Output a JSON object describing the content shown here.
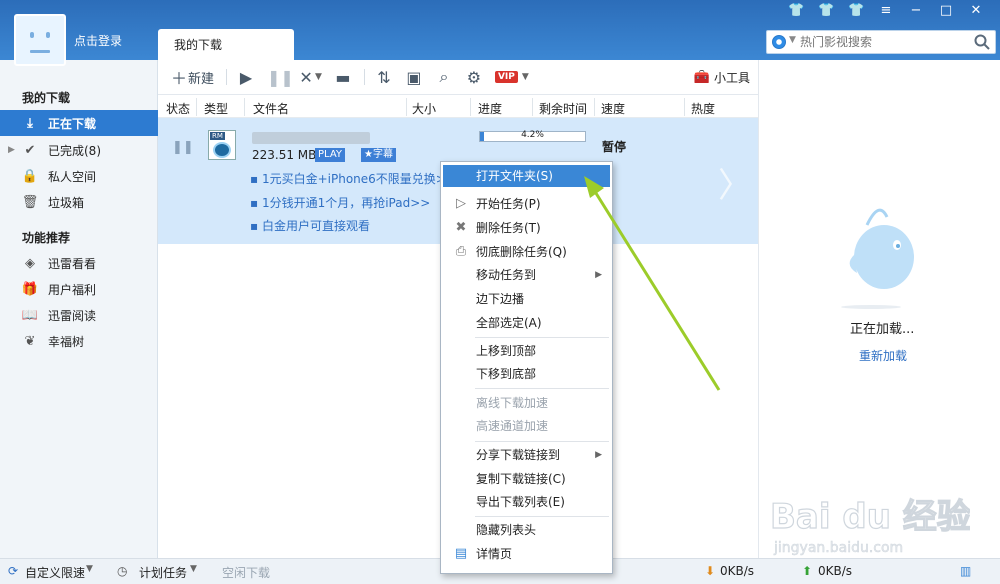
{
  "header": {
    "login_text": "点击登录",
    "active_tab": "我的下载",
    "search_placeholder": "热门影视搜索"
  },
  "sidebar": {
    "section1_title": "我的下载",
    "items1": [
      {
        "label": "正在下载",
        "icon": "download-icon",
        "active": true
      },
      {
        "label": "已完成(8)",
        "icon": "check-icon"
      },
      {
        "label": "私人空间",
        "icon": "lock-icon"
      },
      {
        "label": "垃圾箱",
        "icon": "trash-icon"
      }
    ],
    "section2_title": "功能推荐",
    "items2": [
      {
        "label": "迅雷看看",
        "icon": "shield-play-icon"
      },
      {
        "label": "用户福利",
        "icon": "gift-icon"
      },
      {
        "label": "迅雷阅读",
        "icon": "book-icon"
      },
      {
        "label": "幸福树",
        "icon": "leaf-icon"
      }
    ]
  },
  "toolbar": {
    "new_label": "新建",
    "vip_label": "VIP",
    "small_tools_label": "小工具"
  },
  "table": {
    "columns": [
      "状态",
      "类型",
      "文件名",
      "大小",
      "进度",
      "剩余时间",
      "速度",
      "热度"
    ]
  },
  "task": {
    "size": "223.51 MB",
    "play_badge": "PLAY",
    "subtitle_badge": "★字幕",
    "progress_label": "4.2%",
    "progress_value": 0.042,
    "speed_status": "暂停",
    "promos": [
      "1元买白金+iPhone6不限量兑换>",
      "1分钱开通1个月，再抢iPad>>",
      "白金用户可直接观看"
    ]
  },
  "context_menu": {
    "items": [
      {
        "label": "打开文件夹(S)",
        "selected": true
      },
      {
        "label": "开始任务(P)",
        "icon": "play-icon"
      },
      {
        "label": "删除任务(T)",
        "icon": "delete-x-icon"
      },
      {
        "label": "彻底删除任务(Q)",
        "icon": "printer-icon"
      },
      {
        "label": "移动任务到",
        "submenu": true
      },
      {
        "label": "边下边播"
      },
      {
        "label": "全部选定(A)"
      },
      {
        "label": "上移到顶部"
      },
      {
        "label": "下移到底部"
      },
      {
        "label": "离线下载加速",
        "disabled": true
      },
      {
        "label": "高速通道加速",
        "disabled": true
      },
      {
        "label": "分享下载链接到",
        "submenu": true
      },
      {
        "label": "复制下载链接(C)"
      },
      {
        "label": "导出下载列表(E)"
      },
      {
        "label": "隐藏列表头"
      },
      {
        "label": "详情页",
        "icon": "window-icon"
      }
    ]
  },
  "right_panel": {
    "loading": "正在加载...",
    "reload": "重新加载"
  },
  "statusbar": {
    "speed_limit": "自定义限速",
    "plan_task": "计划任务",
    "idle_download": "空闲下载",
    "down_speed": "0KB/s",
    "up_speed": "0KB/s"
  },
  "watermark": {
    "brand": "Bai du 经验",
    "url": "jingyan.baidu.com"
  },
  "colors": {
    "accent": "#2d7bd1",
    "annotation_arrow": "#9ccc2a",
    "link": "#2f6fc3"
  }
}
